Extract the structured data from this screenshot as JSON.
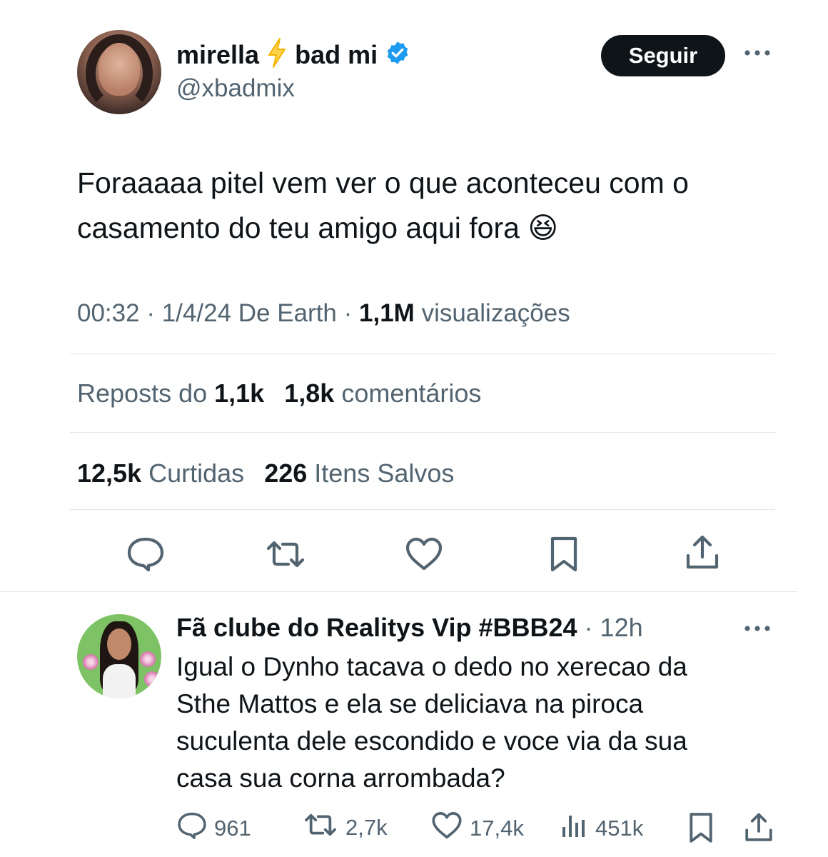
{
  "tweet": {
    "display_name": "mirella",
    "display_name_suffix": "bad mi",
    "handle": "@xbadmix",
    "follow_label": "Seguir",
    "text": "Foraaaaa pitel vem ver o que aconteceu com o casamento do teu amigo aqui fora 😆",
    "time": "00:32",
    "date": "1/4/24",
    "source": "De Earth",
    "views_count": "1,1M",
    "views_label": "visualizações",
    "reposts_label": "Reposts do",
    "reposts_count": "1,1k",
    "comments_count": "1,8k",
    "comments_label": "comentários",
    "likes_count": "12,5k",
    "likes_label": "Curtidas",
    "bookmarks_count": "226",
    "bookmarks_label": "Itens Salvos",
    "icons": {
      "name_emoji": "lightning-icon",
      "verified": "verified-badge-icon",
      "more": "more-icon"
    }
  },
  "reply": {
    "display_name": "Fã clube do Realitys Vip #BBB24",
    "separator": "·",
    "time": "12h",
    "text": "Igual o Dynho tacava o dedo no xerecao da Sthe Mattos e ela se deliciava na piroca suculenta dele escondido e voce via da sua casa sua corna arrombada?",
    "replies": "961",
    "reposts": "2,7k",
    "likes": "17,4k",
    "views": "451k"
  },
  "colors": {
    "text": "#0f1419",
    "secondary": "#536471",
    "divider": "#e1e8ed",
    "verified": "#1d9bf0",
    "lightning": "#f4b400"
  }
}
